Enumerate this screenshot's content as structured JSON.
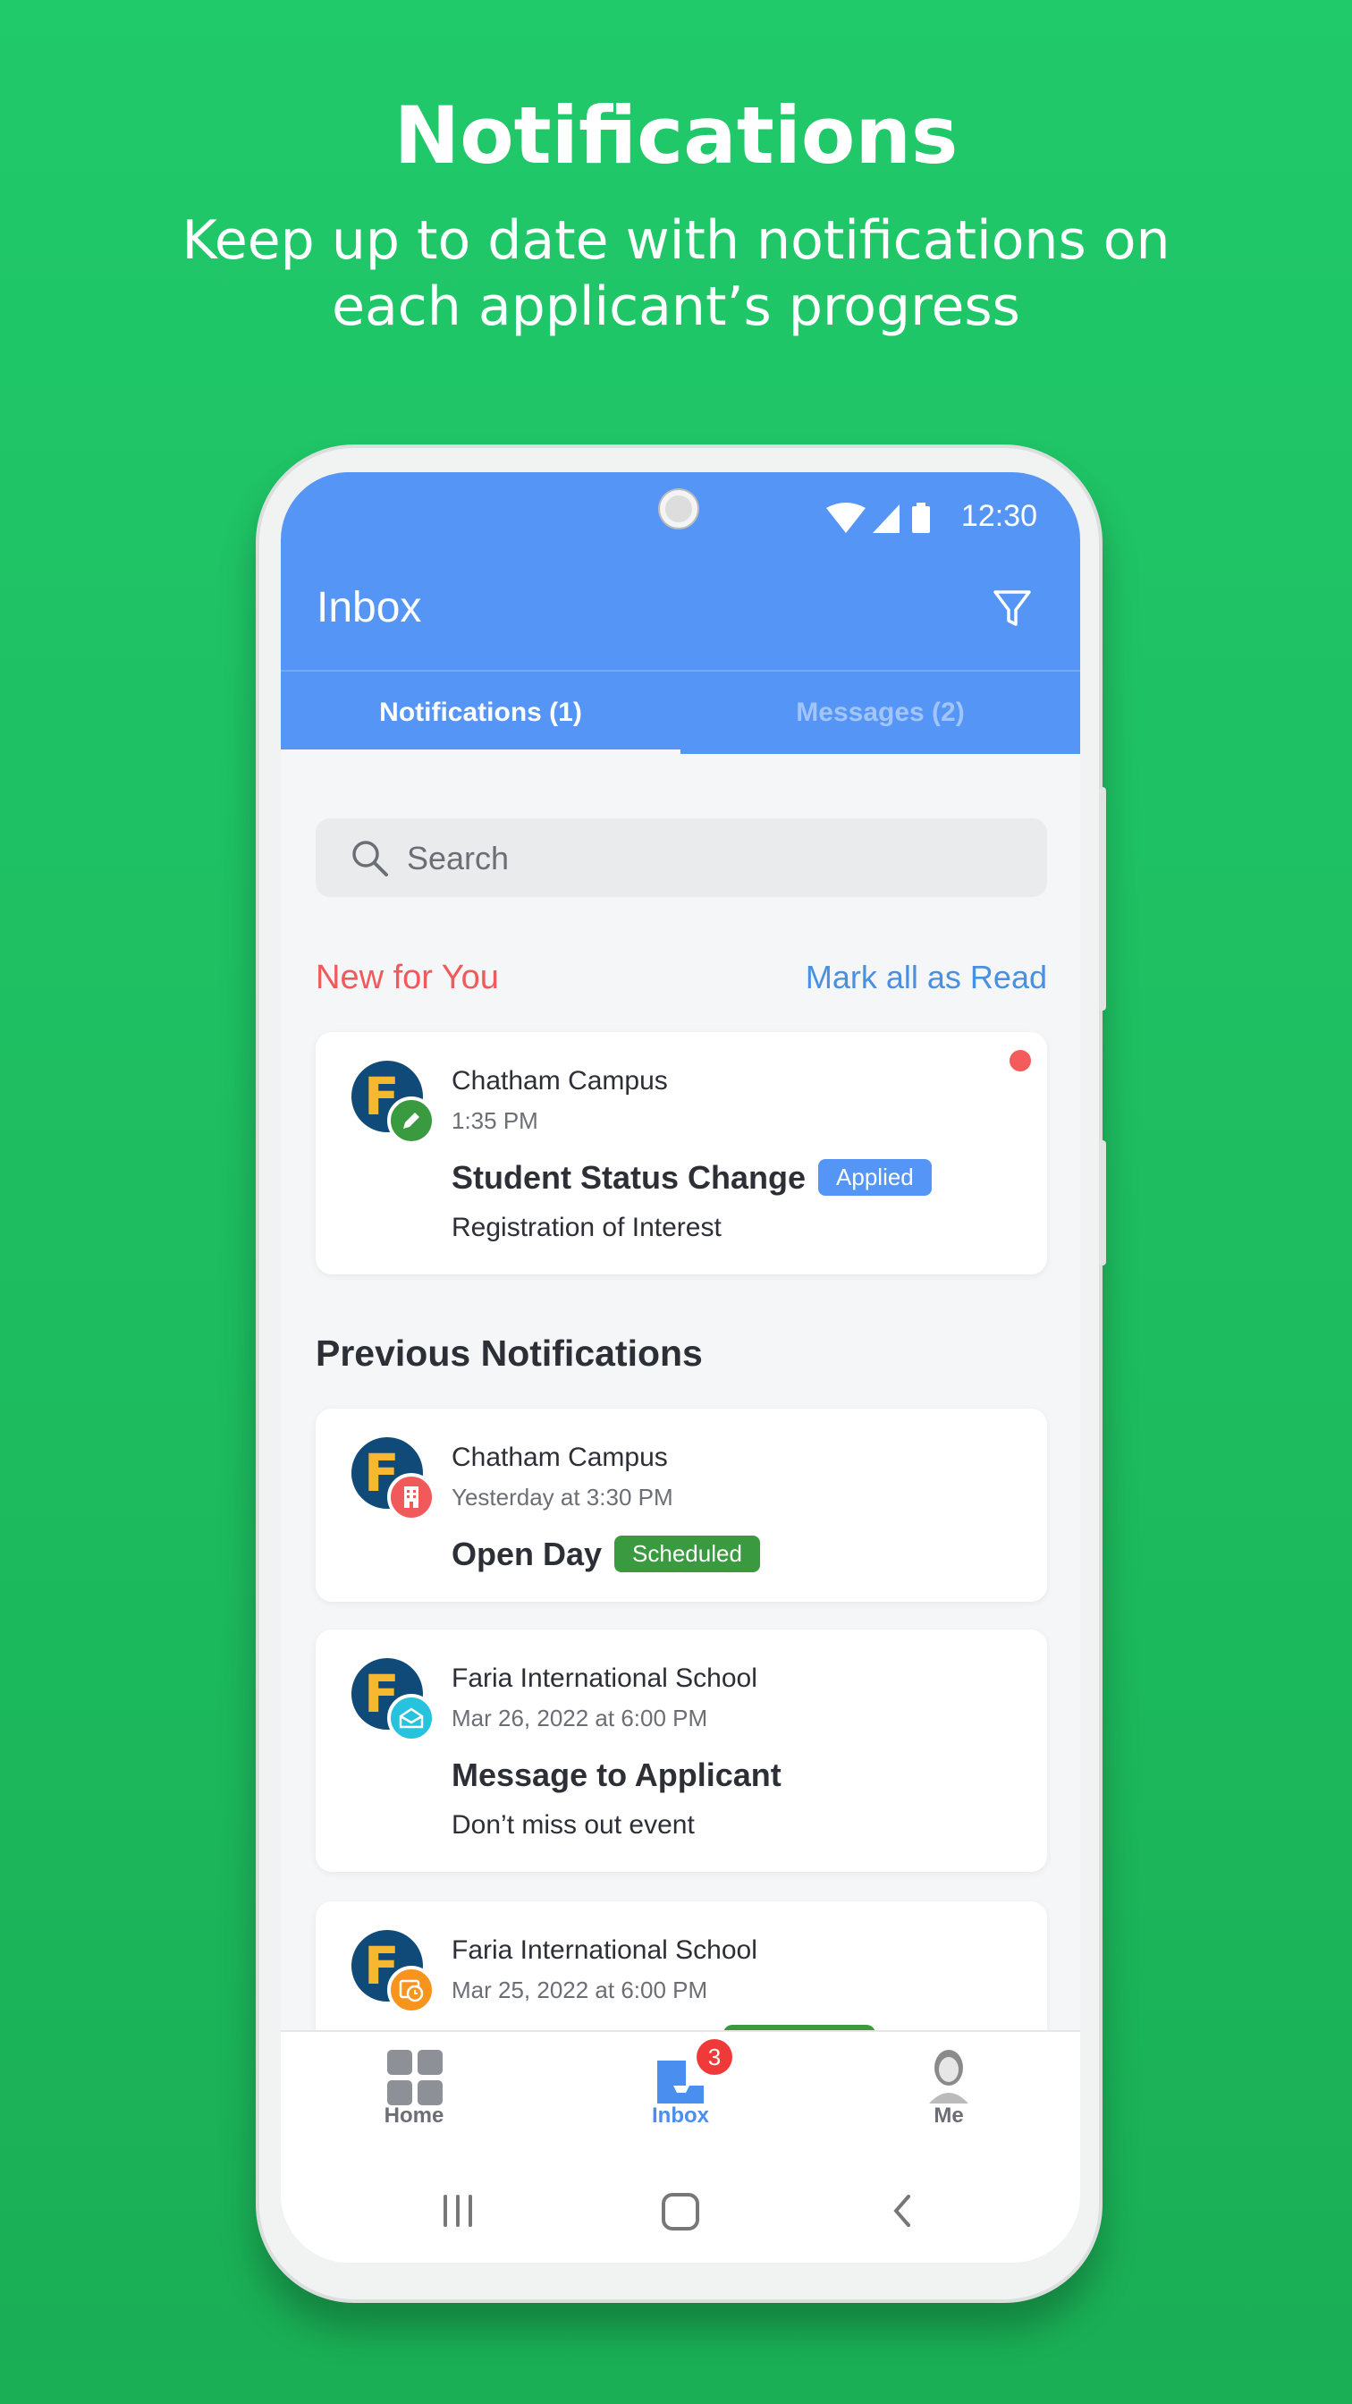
{
  "hero": {
    "title": "Notifications",
    "subtitle_line1": "Keep up to date with notifications on",
    "subtitle_line2": "each applicant’s progress"
  },
  "status_bar": {
    "time": "12:30",
    "icons": [
      "wifi-icon",
      "signal-icon",
      "battery-icon"
    ]
  },
  "header": {
    "title": "Inbox",
    "filter_icon": "filter-icon"
  },
  "tabs": [
    {
      "label": "Notifications (1)",
      "active": true
    },
    {
      "label": "Messages (2)",
      "active": false
    }
  ],
  "search": {
    "placeholder": "Search"
  },
  "new_section": {
    "title": "New for You",
    "action": "Mark all as Read"
  },
  "previous_section": {
    "title": "Previous Notifications"
  },
  "notifications_new": [
    {
      "org": "Chatham Campus",
      "time": "1:35 PM",
      "title": "Student Status Change",
      "status": "Applied",
      "status_color": "#5595f5",
      "subtitle": "Registration of Interest",
      "badge_icon": "pencil-icon",
      "badge_color": "#3a9a3f",
      "unread": true
    }
  ],
  "notifications_previous": [
    {
      "org": "Chatham Campus",
      "time": "Yesterday at 3:30 PM",
      "title": "Open Day",
      "status": "Scheduled",
      "status_color": "#3a9a3f",
      "badge_icon": "building-icon",
      "badge_color": "#f05a5a"
    },
    {
      "org": "Faria International School",
      "time": "Mar 26, 2022 at 6:00 PM",
      "title": "Message to Applicant",
      "subtitle": "Don’t miss out event",
      "badge_icon": "envelope-icon",
      "badge_color": "#27c2de"
    },
    {
      "org": "Faria International School",
      "time": "Mar 25, 2022 at 6:00 PM",
      "badge_icon": "calendar-clock-icon",
      "badge_color": "#f7941d"
    }
  ],
  "logo_letter": "F",
  "bottom_nav": [
    {
      "label": "Home"
    },
    {
      "label": "Inbox",
      "badge": "3",
      "active": true
    },
    {
      "label": "Me"
    }
  ],
  "colors": {
    "accent": "#5595f5",
    "background": "#20c96a",
    "new_red": "#f05a5a"
  }
}
